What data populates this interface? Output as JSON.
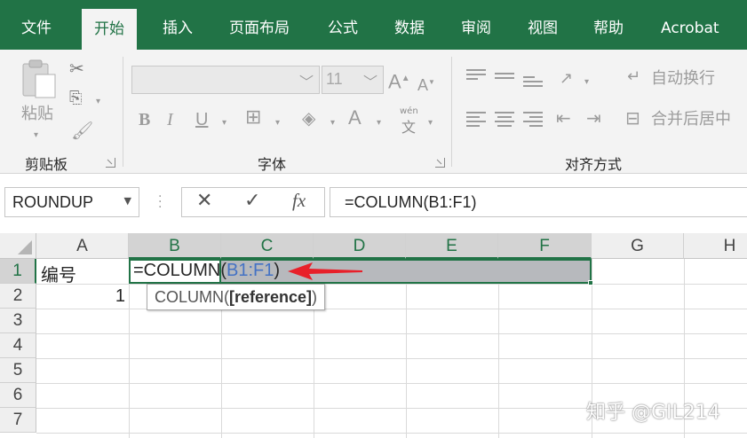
{
  "ribbon_tabs": [
    "文件",
    "开始",
    "插入",
    "页面布局",
    "公式",
    "数据",
    "审阅",
    "视图",
    "帮助",
    "Acrobat"
  ],
  "active_tab": "开始",
  "clipboard_group": {
    "label": "剪贴板",
    "paste_label": "粘贴"
  },
  "font_group": {
    "label": "字体",
    "font_size": "11",
    "phonetic_glyph_top": "wén",
    "phonetic_glyph_bottom": "文"
  },
  "alignment_group": {
    "label": "对齐方式",
    "wrap_text": "自动换行",
    "merge_center": "合并后居中"
  },
  "name_box": "ROUNDUP",
  "formula_bar": {
    "cancel_icon": "✕",
    "enter_icon": "✓",
    "function_icon": "fx",
    "content": "=COLUMN(B1:F1)"
  },
  "columns": [
    "A",
    "B",
    "C",
    "D",
    "E",
    "F",
    "G",
    "H"
  ],
  "rows": [
    "1",
    "2",
    "3",
    "4",
    "5",
    "6",
    "7"
  ],
  "cells": {
    "A1": "编号",
    "A2": "1"
  },
  "edit_cell": {
    "prefix": "=COLUMN(",
    "reference": "B1:F1",
    "suffix": ")"
  },
  "tooltip": {
    "prefix": "COLUMN(",
    "bold": "[reference]",
    "suffix": ")"
  },
  "watermark": "知乎 @GIL214",
  "colors": {
    "excel_green": "#217346",
    "reference_blue": "#4472c4",
    "arrow_red": "#e8202a",
    "selection_gray": "#b7b9bd"
  }
}
